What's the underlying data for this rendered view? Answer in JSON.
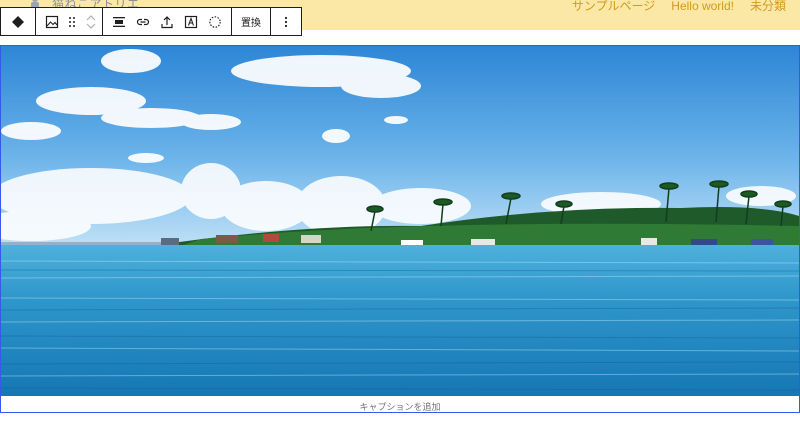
{
  "site": {
    "title": "猫ねこアトリエ",
    "nav": [
      "サンプルページ",
      "Hello world!",
      "未分類"
    ]
  },
  "toolbar": {
    "block_type": "image",
    "items": [
      {
        "name": "block-switcher-icon"
      },
      {
        "name": "image-icon"
      },
      {
        "name": "drag-handle-icon"
      },
      {
        "name": "move-up-icon"
      },
      {
        "name": "move-down-icon"
      },
      {
        "name": "align-icon"
      },
      {
        "name": "link-icon"
      },
      {
        "name": "upload-icon"
      },
      {
        "name": "text-overlay-icon"
      },
      {
        "name": "select-dotted-icon"
      },
      {
        "name": "more-options-icon"
      }
    ],
    "replace_label": "置換"
  },
  "image": {
    "description_icon": "tropical-island-photo",
    "caption_placeholder": "キャプションを追加"
  },
  "colors": {
    "header_bg": "#fce8a6",
    "nav_text": "#d39a1b",
    "selection_border": "#3858e9",
    "toolbar_border": "#1e1e1e"
  }
}
